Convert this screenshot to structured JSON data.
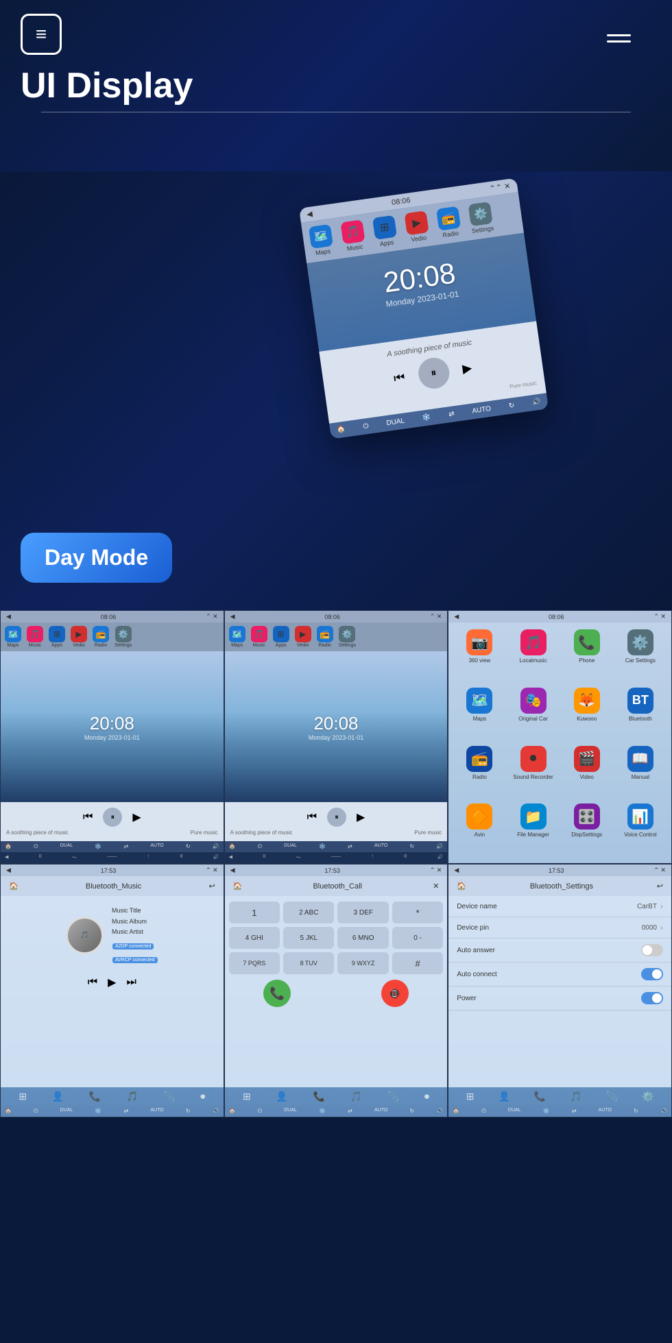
{
  "header": {
    "logo_label": "≡",
    "hamburger_label": "☰",
    "title": "UI Display",
    "divider": true
  },
  "day_mode": {
    "badge_label": "Day Mode",
    "main_screen": {
      "time_bar": "08:06",
      "apps": [
        {
          "name": "Maps",
          "icon": "🔵",
          "color": "#1976D2"
        },
        {
          "name": "Music",
          "icon": "🎵",
          "color": "#E91E63"
        },
        {
          "name": "Apps",
          "icon": "📱",
          "color": "#1565C0"
        },
        {
          "name": "Vedio",
          "icon": "▶️",
          "color": "#D32F2F"
        },
        {
          "name": "Radio",
          "icon": "📻",
          "color": "#1976D2"
        },
        {
          "name": "Settings",
          "icon": "⚙️",
          "color": "#546E7A"
        }
      ],
      "clock": "20:08",
      "date": "Monday  2023-01-01",
      "music_text": "A soothing piece of music",
      "music_label_right": "Pure music"
    }
  },
  "grid_row1": [
    {
      "type": "player",
      "top_bar_time": "08:06",
      "clock": "20:08",
      "date": "Monday  2023-01-01",
      "music_left": "A soothing piece of music",
      "music_right": "Pure music",
      "bottom_items": [
        "🏠",
        "⏻",
        "DUAL",
        "❄️",
        "⇄",
        "AUTO",
        "↻",
        "🔊"
      ]
    },
    {
      "type": "player",
      "top_bar_time": "08:06",
      "clock": "20:08",
      "date": "Monday  2023-01-01",
      "music_left": "A soothing piece of music",
      "music_right": "Pure music",
      "bottom_items": [
        "🏠",
        "⏻",
        "DUAL",
        "❄️",
        "⇄",
        "AUTO",
        "↻",
        "🔊"
      ]
    },
    {
      "type": "apps_grid",
      "top_bar_time": "08:06",
      "apps": [
        {
          "name": "360 view",
          "icon": "📷",
          "color": "#FF6B35"
        },
        {
          "name": "Localmusic",
          "icon": "🎵",
          "color": "#E91E63"
        },
        {
          "name": "Phone",
          "icon": "📞",
          "color": "#4CAF50"
        },
        {
          "name": "Car Settings",
          "icon": "⚙️",
          "color": "#546E7A"
        },
        {
          "name": "Maps",
          "icon": "🗺️",
          "color": "#1976D2"
        },
        {
          "name": "Original Car",
          "icon": "🎭",
          "color": "#9C27B0"
        },
        {
          "name": "Kuwooo",
          "icon": "🦊",
          "color": "#FF9800"
        },
        {
          "name": "Bluetooth",
          "icon": "🔷",
          "color": "#1565C0"
        },
        {
          "name": "Radio",
          "icon": "📻",
          "color": "#0D47A1"
        },
        {
          "name": "Sound Recorder",
          "icon": "⭕",
          "color": "#E53935"
        },
        {
          "name": "Video",
          "icon": "🎬",
          "color": "#D32F2F"
        },
        {
          "name": "Manual",
          "icon": "📖",
          "color": "#1565C0"
        },
        {
          "name": "Avin",
          "icon": "🔶",
          "color": "#FF8F00"
        },
        {
          "name": "File Manager",
          "icon": "📁",
          "color": "#0288D1"
        },
        {
          "name": "DispSettings",
          "icon": "🎛️",
          "color": "#7B1FA2"
        },
        {
          "name": "Voice Control",
          "icon": "📊",
          "color": "#1976D2"
        }
      ]
    }
  ],
  "grid_row2": [
    {
      "type": "bt_music",
      "top_bar_time": "17:53",
      "title": "Bluetooth_Music",
      "music_title": "Music Title",
      "music_album": "Music Album",
      "music_artist": "Music Artist",
      "badge1": "A2DP connected",
      "badge2": "AVRCP connected",
      "bottom_tabs": [
        "⊞",
        "👤",
        "📞",
        "🎵",
        "📎",
        "⏺"
      ]
    },
    {
      "type": "bt_call",
      "top_bar_time": "17:53",
      "title": "Bluetooth_Call",
      "dialpad": [
        "1",
        "2 ABC",
        "3 DEF",
        "*",
        "4 GHI",
        "5 JKL",
        "6 MNO",
        "0 -",
        "7 PQRS",
        "8 TUV",
        "9 WXYZ",
        "#"
      ],
      "bottom_tabs": [
        "⊞",
        "👤",
        "📞",
        "🎵",
        "📎",
        "⏺"
      ]
    },
    {
      "type": "bt_settings",
      "top_bar_time": "17:53",
      "title": "Bluetooth_Settings",
      "settings": [
        {
          "label": "Device name",
          "value": "CarBT",
          "type": "chevron"
        },
        {
          "label": "Device pin",
          "value": "0000",
          "type": "chevron"
        },
        {
          "label": "Auto answer",
          "value": "",
          "type": "toggle_off"
        },
        {
          "label": "Auto connect",
          "value": "",
          "type": "toggle_on"
        },
        {
          "label": "Power",
          "value": "",
          "type": "toggle_on"
        }
      ],
      "bottom_tabs": [
        "⊞",
        "👤",
        "📞",
        "🎵",
        "📎",
        "⏺"
      ]
    }
  ]
}
